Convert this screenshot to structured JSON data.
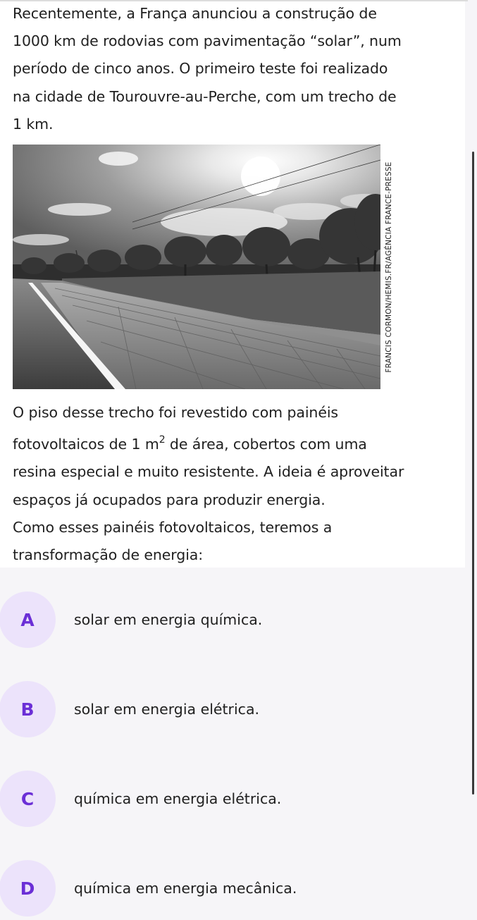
{
  "question": {
    "intro": "Recentemente, a França anunciou a construção de\n1000 km de rodovias com pavimentação “solar”, num\nperíodo de cinco anos. O primeiro teste foi realizado\nna cidade de Tourouvre-au-Perche, com um trecho de\n1 km.",
    "photo_credit": "FRANCIS CORMON/HEMIS.FR/AGÊNCIA FRANCE-PRESSE",
    "body_line1": "O piso desse trecho foi revestido com painéis",
    "body_line2_pre": "fotovoltaicos de 1 m",
    "body_line2_sup": "2",
    "body_line2_post": " de área, cobertos com uma",
    "body_rest": "resina especial e muito resistente. A ideia é aproveitar\nespaços já ocupados para produzir energia.\nComo esses painéis fotovoltaicos, teremos a\ntransformação de energia:"
  },
  "options": [
    {
      "letter": "A",
      "text": "solar em energia química."
    },
    {
      "letter": "B",
      "text": "solar em energia elétrica."
    },
    {
      "letter": "C",
      "text": "química em energia elétrica."
    },
    {
      "letter": "D",
      "text": "química em energia mecânica."
    }
  ],
  "colors": {
    "accent": "#6b2fd6",
    "option_bg": "#ece3fb",
    "page_bg": "#f6f5f8",
    "card_bg": "#ffffff"
  }
}
